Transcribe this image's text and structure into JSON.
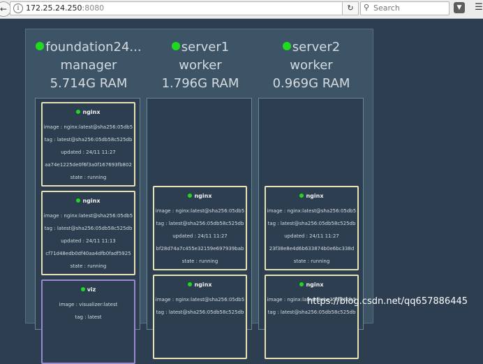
{
  "browser": {
    "url_host": "172.25.24.250",
    "url_port": ":8080",
    "search_placeholder": "Search"
  },
  "nodes": [
    {
      "name": "foundation24...",
      "role": "manager",
      "ram": "5.714G RAM",
      "tasks": [
        {
          "name": "nginx",
          "image": "image : nginx:latest@sha256:05db5",
          "tag": "tag : latest@sha256:05db58c525db",
          "updated": "updated : 24/11 11:27",
          "id": "aa74e1225de0f6f3a0f167693fb802",
          "state": "state : running"
        },
        {
          "name": "nginx",
          "image": "image : nginx:latest@sha256:05db5",
          "tag": "tag : latest@sha256:05db58c525db",
          "updated": "updated : 24/11 11:13",
          "id": "cf71d48edb0df40aa4dfb0fadf5925",
          "state": "state : running"
        },
        {
          "name": "viz",
          "image": "image : visualizer:latest",
          "tag": "tag : latest"
        }
      ]
    },
    {
      "name": "server1",
      "role": "worker",
      "ram": "1.796G RAM",
      "tasks": [
        {
          "name": "nginx",
          "image": "image : nginx:latest@sha256:05db5",
          "tag": "tag : latest@sha256:05db58c525db",
          "updated": "updated : 24/11 11:27",
          "id": "bf28d74a7c455e32159e697939bab",
          "state": "state : running"
        },
        {
          "name": "nginx",
          "image": "image : nginx:latest@sha256:05db5",
          "tag": "tag : latest@sha256:05db58c525db"
        }
      ]
    },
    {
      "name": "server2",
      "role": "worker",
      "ram": "0.969G RAM",
      "tasks": [
        {
          "name": "nginx",
          "image": "image : nginx:latest@sha256:05db5",
          "tag": "tag : latest@sha256:05db58c525db",
          "updated": "updated : 24/11 11:27",
          "id": "23f38e8e4d6b633874b0e6bc338d",
          "state": "state : running"
        },
        {
          "name": "nginx",
          "image": "image : nginx:latest@sha256:05db5",
          "tag": "tag : latest@sha256:05db58c525db"
        }
      ]
    }
  ],
  "watermark": "https://blog.csdn.net/qq657886445",
  "colors": {
    "background": "#2c3e50",
    "swarm_panel": "#3d5466",
    "status_green": "#1fdb1f",
    "task_border": "#e9e3b3",
    "viz_border": "#9a8ad0"
  }
}
